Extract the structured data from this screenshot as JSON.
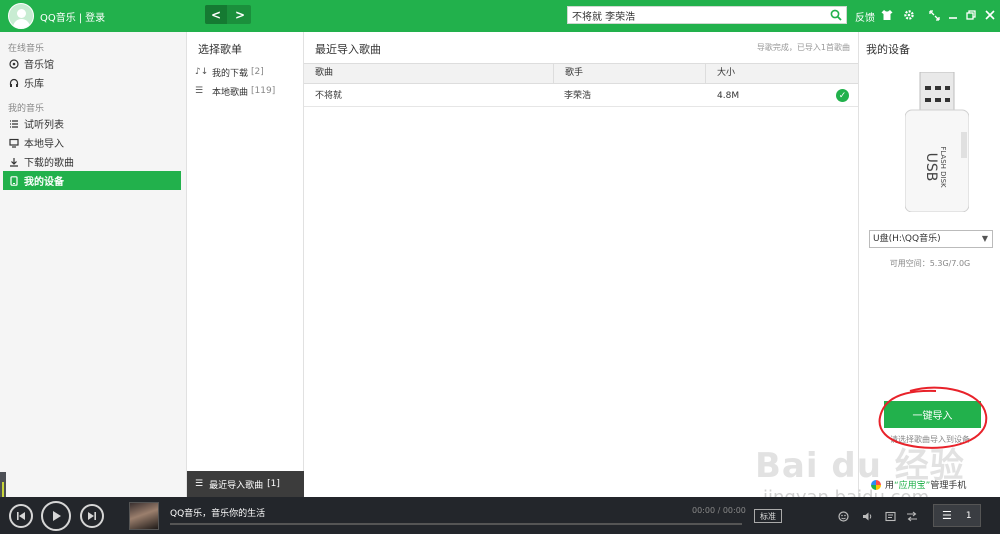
{
  "topbar": {
    "app_name": "QQ音乐",
    "separator": "|",
    "login_label": "登录",
    "nav_back": "<",
    "nav_forward": ">",
    "search_value": "不将就 李荣浩",
    "feedback_label": "反馈",
    "icons": [
      "skin-icon",
      "settings-icon",
      "minimode-icon",
      "minimize-icon",
      "restore-icon",
      "close-icon"
    ]
  },
  "sidebar": {
    "online_title": "在线音乐",
    "online_items": [
      {
        "label": "音乐馆",
        "icon": "music-hall-icon"
      },
      {
        "label": "乐库",
        "icon": "headphones-icon"
      }
    ],
    "my_title": "我的音乐",
    "my_items": [
      {
        "label": "试听列表",
        "icon": "list-icon"
      },
      {
        "label": "本地导入",
        "icon": "monitor-icon"
      },
      {
        "label": "下载的歌曲",
        "icon": "download-icon"
      },
      {
        "label": "我的设备",
        "icon": "device-icon",
        "active": true
      }
    ]
  },
  "playlist": {
    "title": "选择歌单",
    "items": [
      {
        "label": "我的下载",
        "count": "[2]"
      },
      {
        "label": "本地歌曲",
        "count": "[119]"
      }
    ],
    "recent_label": "最近导入歌曲",
    "recent_count": "[1]"
  },
  "main": {
    "title": "最近导入歌曲",
    "status": "导歌完成，已导入1首歌曲",
    "columns": [
      "歌曲",
      "歌手",
      "大小"
    ],
    "rows": [
      {
        "song": "不将就",
        "singer": "李荣浩",
        "size": "4.8M",
        "status": "done"
      }
    ]
  },
  "device": {
    "title": "我的设备",
    "usb_text_1": "USB",
    "usb_text_2": "FLASH DISK",
    "drive_value": "U盘(H:\\QQ音乐)",
    "space_label": "可用空间：5.3G/7.0G",
    "import_button": "一键导入",
    "import_hint": "请选择歌曲导入到设备",
    "manage_prefix": "用",
    "manage_app": "“应用宝”",
    "manage_suffix": "管理手机"
  },
  "player": {
    "now_playing": "QQ音乐，音乐你的生活",
    "time": "00:00 / 00:00",
    "quality": "标准",
    "queue_count": "1",
    "progress": 0
  },
  "watermark": {
    "main": "Bai du 经验",
    "url": "jingyan.baidu.com"
  },
  "colors": {
    "brand_green": "#22b14c",
    "player_bg": "#23262b",
    "annotation_red": "#e8222a"
  }
}
